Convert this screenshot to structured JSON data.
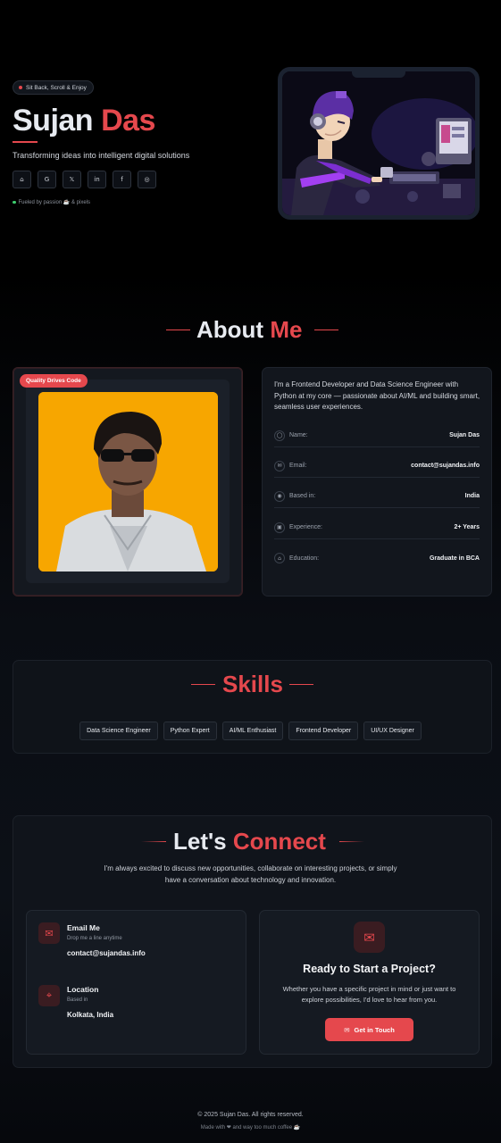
{
  "hero": {
    "badge": "Sit Back, Scroll & Enjoy",
    "first_name": "Sujan",
    "last_name": "Das",
    "tagline": "Transforming ideas into intelligent digital solutions",
    "socials": [
      {
        "name": "github-icon",
        "glyph": "⌂"
      },
      {
        "name": "google-icon",
        "glyph": "G"
      },
      {
        "name": "x-icon",
        "glyph": "𝕏"
      },
      {
        "name": "linkedin-icon",
        "glyph": "in"
      },
      {
        "name": "facebook-icon",
        "glyph": "f"
      },
      {
        "name": "instagram-icon",
        "glyph": "◎"
      }
    ],
    "fueled": "Fueled by passion ☕ & pixels"
  },
  "about": {
    "title_a": "About",
    "title_b": "Me",
    "badge": "Quality Drives Code",
    "bio": "I'm a Frontend Developer and Data Science Engineer with Python at my core — passionate about AI/ML and building smart, seamless user experiences.",
    "rows": [
      {
        "label": "Name:",
        "value": "Sujan Das",
        "icon": "user-icon",
        "glyph": "◯"
      },
      {
        "label": "Email:",
        "value": "contact@sujandas.info",
        "icon": "mail-icon",
        "glyph": "✉"
      },
      {
        "label": "Based in:",
        "value": "India",
        "icon": "location-icon",
        "glyph": "◉"
      },
      {
        "label": "Experience:",
        "value": "2+ Years",
        "icon": "briefcase-icon",
        "glyph": "▣"
      },
      {
        "label": "Education:",
        "value": "Graduate in BCA",
        "icon": "graduation-icon",
        "glyph": "⌂"
      }
    ]
  },
  "skills": {
    "title": "Skills",
    "items": [
      "Data Science Engineer",
      "Python Expert",
      "AI/ML Enthusiast",
      "Frontend Developer",
      "UI/UX Designer"
    ]
  },
  "connect": {
    "title_a": "Let's",
    "title_b": "Connect",
    "subtitle": "I'm always excited to discuss new opportunities, collaborate on interesting projects, or simply have a conversation about technology and innovation.",
    "email": {
      "title": "Email Me",
      "small": "Drop me a line anytime",
      "value": "contact@sujandas.info"
    },
    "location": {
      "title": "Location",
      "small": "Based in",
      "value": "Kolkata, India"
    },
    "cta": {
      "title": "Ready to Start a Project?",
      "text": "Whether you have a specific project in mind or just want to explore possibilities, I'd love to hear from you.",
      "button": "Get in Touch"
    }
  },
  "footer": {
    "copyright": "© 2025 Sujan Das. All rights reserved.",
    "made": "Made with ❤ and way too much coffee ☕"
  },
  "colors": {
    "accent": "#e5484d",
    "background": "#000000",
    "card": "#12161d"
  }
}
